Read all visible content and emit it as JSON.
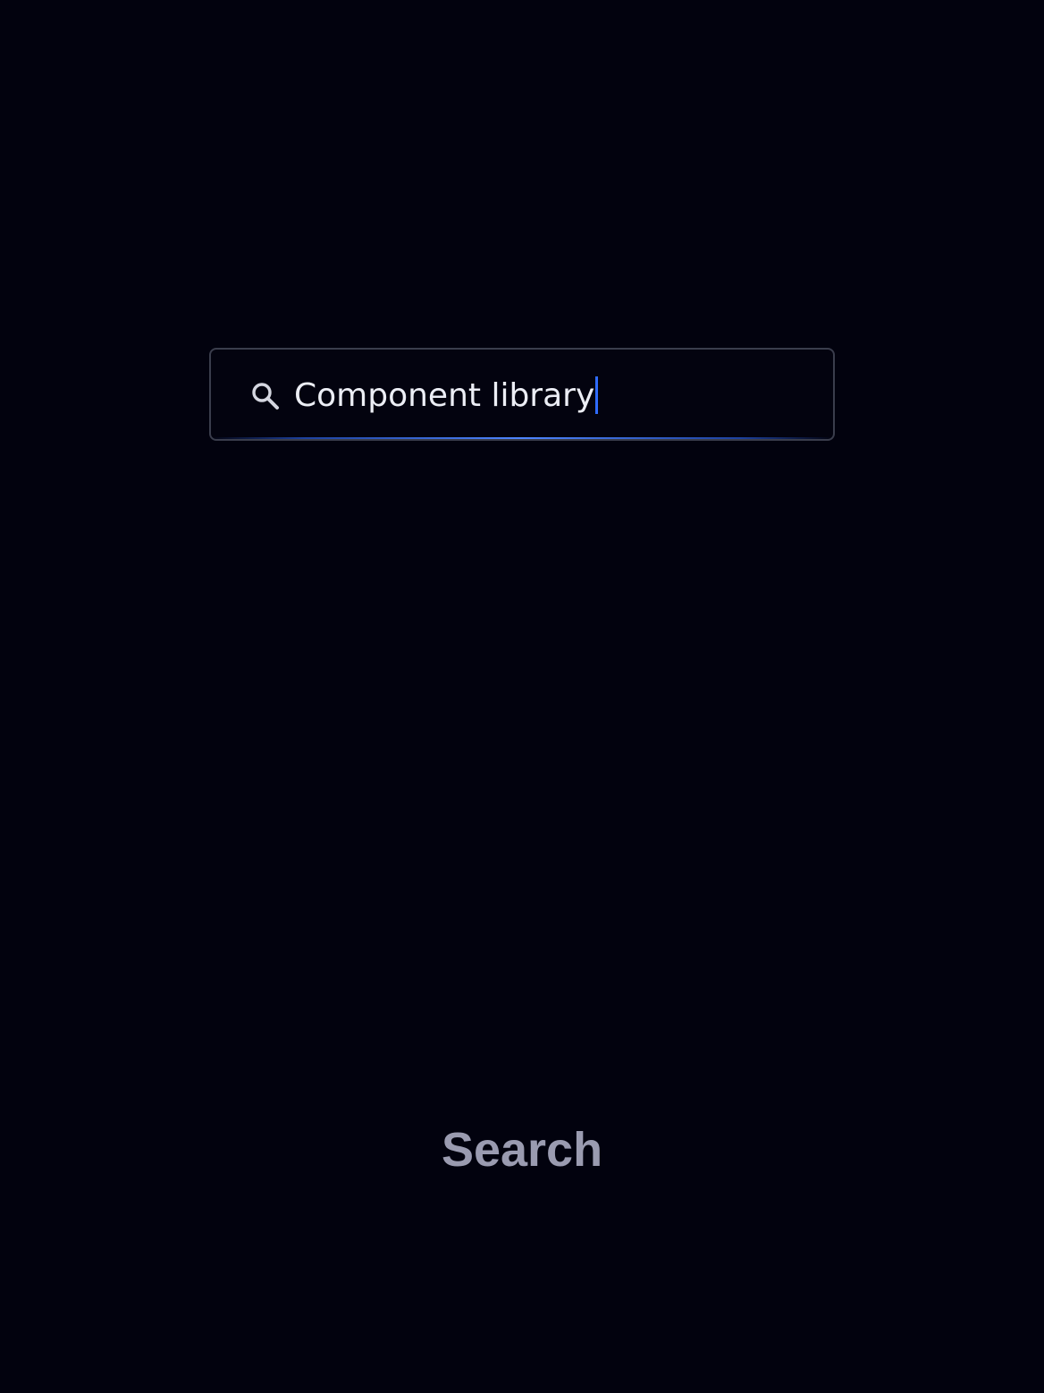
{
  "search": {
    "icon": "search-icon",
    "value": "Component library"
  },
  "caption": "Search",
  "colors": {
    "background": "#02020e",
    "border": "#3a3d4c",
    "accent": "#2f6bff",
    "text": "#eceef5",
    "caption": "#9a9bb0"
  }
}
